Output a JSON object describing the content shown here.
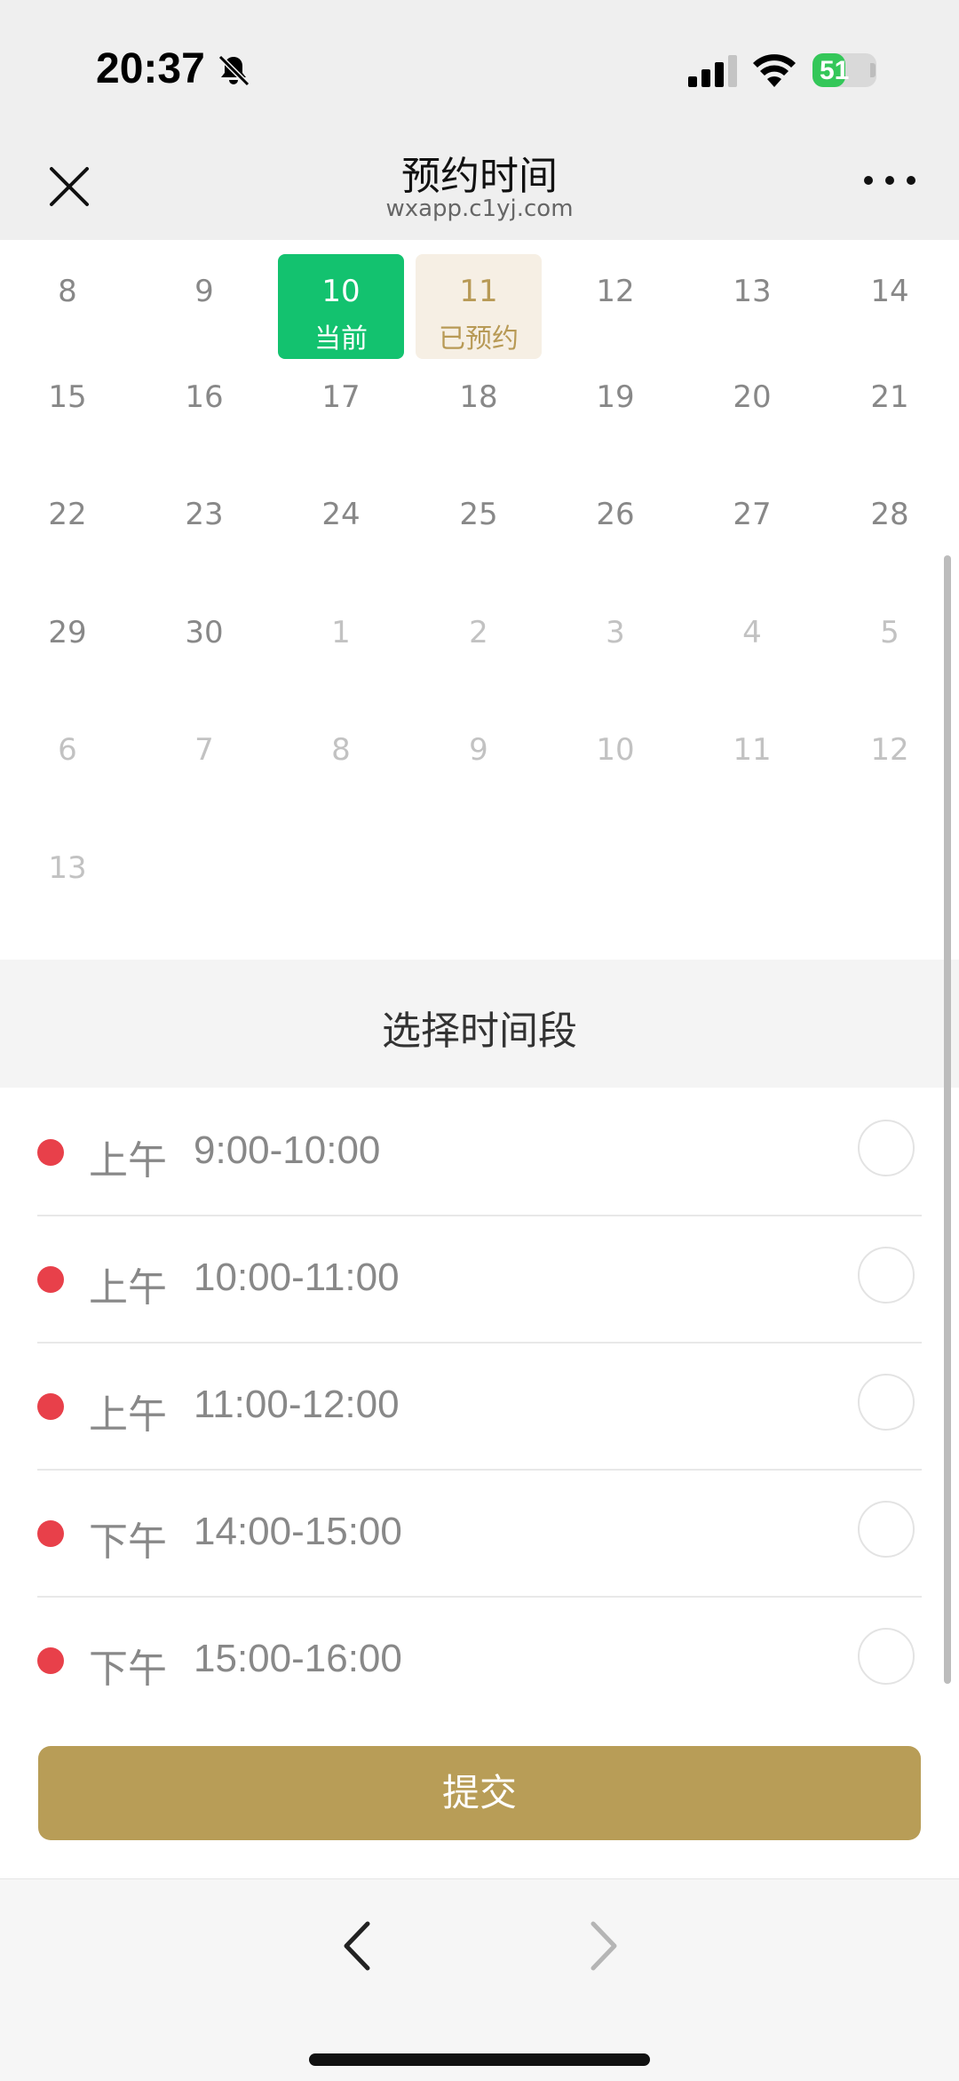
{
  "status_bar": {
    "time": "20:37",
    "battery_level": "51",
    "battery_fraction": 0.51,
    "icons": [
      "bell-mute-icon",
      "signal-icon",
      "wifi-icon",
      "battery-charging-icon"
    ]
  },
  "nav": {
    "title": "预约时间",
    "subtitle": "wxapp.c1yj.com",
    "close_icon": "close-icon",
    "more_icon": "more-icon"
  },
  "calendar": {
    "rows": [
      [
        {
          "d": "8"
        },
        {
          "d": "9"
        },
        {
          "d": "10",
          "state": "current",
          "label": "当前"
        },
        {
          "d": "11",
          "state": "booked",
          "label": "已预约"
        },
        {
          "d": "12"
        },
        {
          "d": "13"
        },
        {
          "d": "14"
        }
      ],
      [
        {
          "d": "15"
        },
        {
          "d": "16"
        },
        {
          "d": "17"
        },
        {
          "d": "18"
        },
        {
          "d": "19"
        },
        {
          "d": "20"
        },
        {
          "d": "21"
        }
      ],
      [
        {
          "d": "22"
        },
        {
          "d": "23"
        },
        {
          "d": "24"
        },
        {
          "d": "25"
        },
        {
          "d": "26"
        },
        {
          "d": "27"
        },
        {
          "d": "28"
        }
      ],
      [
        {
          "d": "29"
        },
        {
          "d": "30"
        },
        {
          "d": "1",
          "dim": true
        },
        {
          "d": "2",
          "dim": true
        },
        {
          "d": "3",
          "dim": true
        },
        {
          "d": "4",
          "dim": true
        },
        {
          "d": "5",
          "dim": true
        }
      ],
      [
        {
          "d": "6",
          "dim": true
        },
        {
          "d": "7",
          "dim": true
        },
        {
          "d": "8",
          "dim": true
        },
        {
          "d": "9",
          "dim": true
        },
        {
          "d": "10",
          "dim": true
        },
        {
          "d": "11",
          "dim": true
        },
        {
          "d": "12",
          "dim": true
        }
      ],
      [
        {
          "d": "13",
          "dim": true
        }
      ]
    ]
  },
  "section": {
    "title": "选择时间段"
  },
  "slots": [
    {
      "period": "上午",
      "time": "9:00-10:00"
    },
    {
      "period": "上午",
      "time": "10:00-11:00"
    },
    {
      "period": "上午",
      "time": "11:00-12:00"
    },
    {
      "period": "下午",
      "time": "14:00-15:00"
    },
    {
      "period": "下午",
      "time": "15:00-16:00"
    }
  ],
  "submit": {
    "label": "提交"
  },
  "bottom_nav": {
    "back_icon": "chevron-left-icon",
    "forward_icon": "chevron-right-icon"
  },
  "colors": {
    "current": "#13c26f",
    "booked_bg": "#f6efe4",
    "booked_text": "#b89a56",
    "submit": "#b89d57",
    "dot": "#e8404a"
  }
}
